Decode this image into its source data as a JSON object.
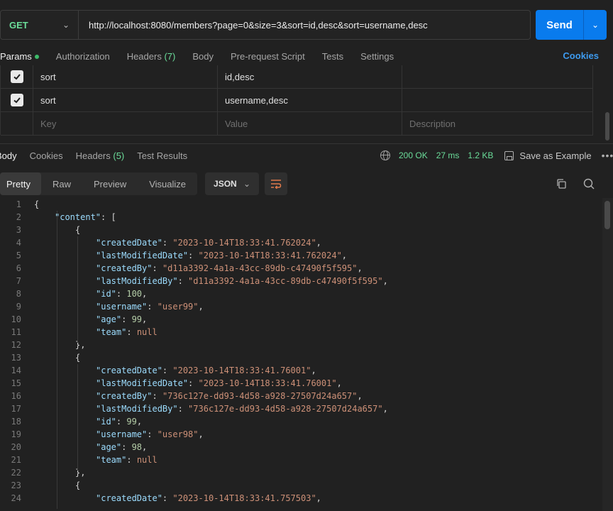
{
  "request": {
    "method": "GET",
    "url": "http://localhost:8080/members?page=0&size=3&sort=id,desc&sort=username,desc",
    "send_label": "Send"
  },
  "req_tabs": {
    "params": "Params",
    "authorization": "Authorization",
    "headers": "Headers",
    "headers_count": "(7)",
    "body": "Body",
    "prerequest": "Pre-request Script",
    "tests": "Tests",
    "settings": "Settings",
    "cookies": "Cookies"
  },
  "params": {
    "rows": [
      {
        "key": "sort",
        "value": "id,desc",
        "checked": true
      },
      {
        "key": "sort",
        "value": "username,desc",
        "checked": true
      }
    ],
    "placeholder": {
      "key": "Key",
      "value": "Value",
      "description": "Description"
    }
  },
  "response": {
    "tabs": {
      "body": "Body",
      "cookies": "Cookies",
      "headers": "Headers",
      "headers_count": "(5)",
      "test_results": "Test Results"
    },
    "status": "200 OK",
    "time": "27 ms",
    "size": "1.2 KB",
    "save_example": "Save as Example",
    "views": {
      "pretty": "Pretty",
      "raw": "Raw",
      "preview": "Preview",
      "visualize": "Visualize"
    },
    "format": "JSON"
  },
  "code_lines": [
    {
      "n": "1",
      "indent": 0,
      "t": [
        [
          "p",
          "{"
        ]
      ]
    },
    {
      "n": "2",
      "indent": 1,
      "t": [
        [
          "k",
          "\"content\""
        ],
        [
          "p",
          ": ["
        ]
      ]
    },
    {
      "n": "3",
      "indent": 2,
      "t": [
        [
          "p",
          "{"
        ]
      ]
    },
    {
      "n": "4",
      "indent": 3,
      "t": [
        [
          "k",
          "\"createdDate\""
        ],
        [
          "p",
          ": "
        ],
        [
          "s",
          "\"2023-10-14T18:33:41.762024\""
        ],
        [
          "p",
          ","
        ]
      ]
    },
    {
      "n": "5",
      "indent": 3,
      "t": [
        [
          "k",
          "\"lastModifiedDate\""
        ],
        [
          "p",
          ": "
        ],
        [
          "s",
          "\"2023-10-14T18:33:41.762024\""
        ],
        [
          "p",
          ","
        ]
      ]
    },
    {
      "n": "6",
      "indent": 3,
      "t": [
        [
          "k",
          "\"createdBy\""
        ],
        [
          "p",
          ": "
        ],
        [
          "s",
          "\"d11a3392-4a1a-43cc-89db-c47490f5f595\""
        ],
        [
          "p",
          ","
        ]
      ]
    },
    {
      "n": "7",
      "indent": 3,
      "t": [
        [
          "k",
          "\"lastModifiedBy\""
        ],
        [
          "p",
          ": "
        ],
        [
          "s",
          "\"d11a3392-4a1a-43cc-89db-c47490f5f595\""
        ],
        [
          "p",
          ","
        ]
      ]
    },
    {
      "n": "8",
      "indent": 3,
      "t": [
        [
          "k",
          "\"id\""
        ],
        [
          "p",
          ": "
        ],
        [
          "n",
          "100"
        ],
        [
          "p",
          ","
        ]
      ]
    },
    {
      "n": "9",
      "indent": 3,
      "t": [
        [
          "k",
          "\"username\""
        ],
        [
          "p",
          ": "
        ],
        [
          "s",
          "\"user99\""
        ],
        [
          "p",
          ","
        ]
      ]
    },
    {
      "n": "10",
      "indent": 3,
      "t": [
        [
          "k",
          "\"age\""
        ],
        [
          "p",
          ": "
        ],
        [
          "n",
          "99"
        ],
        [
          "p",
          ","
        ]
      ]
    },
    {
      "n": "11",
      "indent": 3,
      "t": [
        [
          "k",
          "\"team\""
        ],
        [
          "p",
          ": "
        ],
        [
          "nl",
          "null"
        ]
      ]
    },
    {
      "n": "12",
      "indent": 2,
      "t": [
        [
          "p",
          "},"
        ]
      ]
    },
    {
      "n": "13",
      "indent": 2,
      "t": [
        [
          "p",
          "{"
        ]
      ]
    },
    {
      "n": "14",
      "indent": 3,
      "t": [
        [
          "k",
          "\"createdDate\""
        ],
        [
          "p",
          ": "
        ],
        [
          "s",
          "\"2023-10-14T18:33:41.76001\""
        ],
        [
          "p",
          ","
        ]
      ]
    },
    {
      "n": "15",
      "indent": 3,
      "t": [
        [
          "k",
          "\"lastModifiedDate\""
        ],
        [
          "p",
          ": "
        ],
        [
          "s",
          "\"2023-10-14T18:33:41.76001\""
        ],
        [
          "p",
          ","
        ]
      ]
    },
    {
      "n": "16",
      "indent": 3,
      "t": [
        [
          "k",
          "\"createdBy\""
        ],
        [
          "p",
          ": "
        ],
        [
          "s",
          "\"736c127e-dd93-4d58-a928-27507d24a657\""
        ],
        [
          "p",
          ","
        ]
      ]
    },
    {
      "n": "17",
      "indent": 3,
      "t": [
        [
          "k",
          "\"lastModifiedBy\""
        ],
        [
          "p",
          ": "
        ],
        [
          "s",
          "\"736c127e-dd93-4d58-a928-27507d24a657\""
        ],
        [
          "p",
          ","
        ]
      ]
    },
    {
      "n": "18",
      "indent": 3,
      "t": [
        [
          "k",
          "\"id\""
        ],
        [
          "p",
          ": "
        ],
        [
          "n",
          "99"
        ],
        [
          "p",
          ","
        ]
      ]
    },
    {
      "n": "19",
      "indent": 3,
      "t": [
        [
          "k",
          "\"username\""
        ],
        [
          "p",
          ": "
        ],
        [
          "s",
          "\"user98\""
        ],
        [
          "p",
          ","
        ]
      ]
    },
    {
      "n": "20",
      "indent": 3,
      "t": [
        [
          "k",
          "\"age\""
        ],
        [
          "p",
          ": "
        ],
        [
          "n",
          "98"
        ],
        [
          "p",
          ","
        ]
      ]
    },
    {
      "n": "21",
      "indent": 3,
      "t": [
        [
          "k",
          "\"team\""
        ],
        [
          "p",
          ": "
        ],
        [
          "nl",
          "null"
        ]
      ]
    },
    {
      "n": "22",
      "indent": 2,
      "t": [
        [
          "p",
          "},"
        ]
      ]
    },
    {
      "n": "23",
      "indent": 2,
      "t": [
        [
          "p",
          "{"
        ]
      ]
    },
    {
      "n": "24",
      "indent": 3,
      "t": [
        [
          "k",
          "\"createdDate\""
        ],
        [
          "p",
          ": "
        ],
        [
          "s",
          "\"2023-10-14T18:33:41.757503\""
        ],
        [
          "p",
          ","
        ]
      ]
    }
  ],
  "colors": {
    "send": "#097bed",
    "success": "#6bdd9a",
    "link": "#3d9bf0"
  }
}
